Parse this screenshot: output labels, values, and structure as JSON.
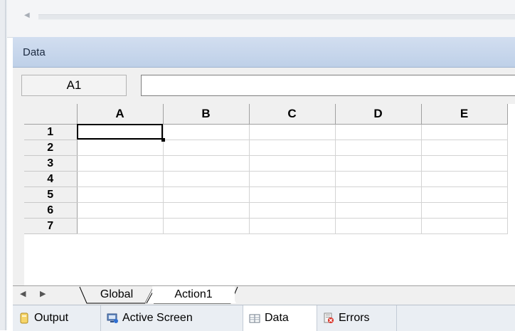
{
  "panel": {
    "title": "Data"
  },
  "formula_bar": {
    "cell_ref": "A1",
    "value": ""
  },
  "grid": {
    "columns": [
      "A",
      "B",
      "C",
      "D",
      "E"
    ],
    "rows": [
      "1",
      "2",
      "3",
      "4",
      "5",
      "6",
      "7"
    ],
    "active_cell": "A1"
  },
  "sheets": {
    "tabs": [
      {
        "label": "Global"
      },
      {
        "label": "Action1"
      }
    ],
    "selected": "Action1"
  },
  "dock": {
    "tabs": [
      {
        "label": "Output",
        "icon": "output-icon"
      },
      {
        "label": "Active Screen",
        "icon": "active-screen-icon"
      },
      {
        "label": "Data",
        "icon": "data-icon"
      },
      {
        "label": "Errors",
        "icon": "errors-icon"
      }
    ],
    "selected": "Data"
  },
  "colors": {
    "panel_title_bg": "#c8d8ee",
    "grid_header_bg": "#f0f0f0",
    "dock_bg": "#eaeef3"
  }
}
